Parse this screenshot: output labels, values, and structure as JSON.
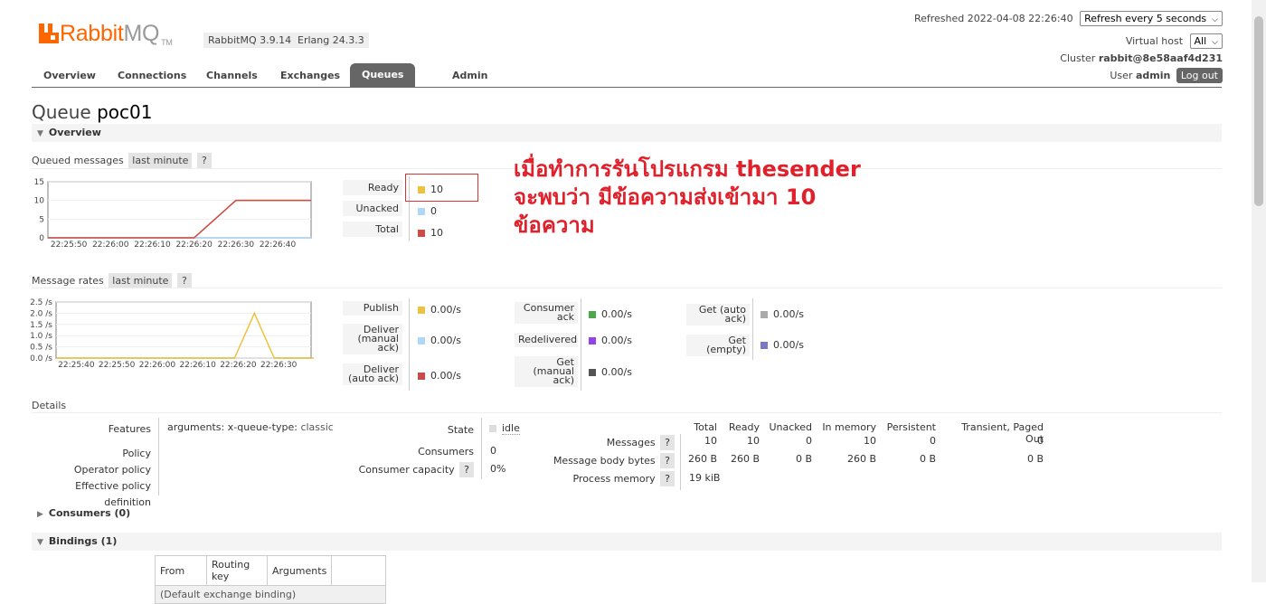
{
  "header": {
    "logo_main": "Rabbit",
    "logo_mq": "MQ",
    "logo_tm": "TM",
    "rabbitmq_version": "RabbitMQ 3.9.14",
    "erlang_version": "Erlang 24.3.3",
    "refreshed_label": "Refreshed 2022-04-08 22:26:40",
    "refresh_select": "Refresh every 5 seconds",
    "vhost_label": "Virtual host",
    "vhost_select": "All",
    "cluster_label": "Cluster",
    "cluster_name": "rabbit@8e58aaf4d231",
    "user_label": "User",
    "user_name": "admin",
    "logout_label": "Log out"
  },
  "nav": [
    "Overview",
    "Connections",
    "Channels",
    "Exchanges",
    "Queues",
    "Admin"
  ],
  "nav_active": "Queues",
  "page": {
    "title_prefix": "Queue",
    "queue_name": "poc01"
  },
  "overview_section": "Overview",
  "queued": {
    "title": "Queued messages",
    "range": "last minute",
    "help": "?",
    "rows": [
      {
        "label": "Ready",
        "value": "10",
        "color": "#edc240"
      },
      {
        "label": "Unacked",
        "value": "0",
        "color": "#afd8f8"
      },
      {
        "label": "Total",
        "value": "10",
        "color": "#cb4b4b"
      }
    ]
  },
  "rates": {
    "title": "Message rates",
    "range": "last minute",
    "help": "?",
    "col1": [
      {
        "label": "Publish",
        "value": "0.00/s",
        "color": "#edc240"
      },
      {
        "label": "Deliver (manual ack)",
        "value": "0.00/s",
        "color": "#afd8f8"
      },
      {
        "label": "Deliver (auto ack)",
        "value": "0.00/s",
        "color": "#cb4b4b"
      }
    ],
    "col2": [
      {
        "label": "Consumer ack",
        "value": "0.00/s",
        "color": "#4da74d"
      },
      {
        "label": "Redelivered",
        "value": "0.00/s",
        "color": "#9440ed"
      },
      {
        "label": "Get (manual ack)",
        "value": "0.00/s",
        "color": "#555555"
      }
    ],
    "col3": [
      {
        "label": "Get (auto ack)",
        "value": "0.00/s",
        "color": "#aaaaaa"
      },
      {
        "label": "Get (empty)",
        "value": "0.00/s",
        "color": "#7c79c3"
      }
    ]
  },
  "annotation": {
    "line1": "เมื่อทำการรันโปรแกรม thesender",
    "line2": "จะพบว่า มีข้อความส่งเข้ามา 10",
    "line3": "ข้อความ"
  },
  "details": {
    "title": "Details",
    "features_label": "Features",
    "arguments_label": "arguments:",
    "argument_key": "x-queue-type:",
    "argument_value": "classic",
    "policy_label": "Policy",
    "operator_policy_label": "Operator policy",
    "effective_policy_label": "Effective policy definition",
    "state_label": "State",
    "state_value": "idle",
    "consumers_label": "Consumers",
    "consumers_value": "0",
    "capacity_label": "Consumer capacity",
    "capacity_value": "0%",
    "help": "?",
    "stats_headers": [
      "Total",
      "Ready",
      "Unacked",
      "In memory",
      "Persistent",
      "Transient, Paged Out"
    ],
    "messages_label": "Messages",
    "messages_values": [
      "10",
      "10",
      "0",
      "10",
      "0",
      "0"
    ],
    "bytes_label": "Message body bytes",
    "bytes_values": [
      "260 B",
      "260 B",
      "0 B",
      "260 B",
      "0 B",
      "0 B"
    ],
    "process_memory_label": "Process memory",
    "process_memory_value": "19 kiB"
  },
  "consumers_section": "Consumers (0)",
  "bindings_section": "Bindings (1)",
  "bindings_table": {
    "headers": [
      "From",
      "Routing key",
      "Arguments"
    ],
    "row": "(Default exchange binding)"
  },
  "chart_data": [
    {
      "type": "line",
      "x": [
        "22:25:50",
        "22:26:00",
        "22:26:10",
        "22:26:20",
        "22:26:30",
        "22:26:40"
      ],
      "ylim": [
        0,
        15
      ],
      "yticks": [
        "15",
        "10",
        "5",
        "0"
      ],
      "series": [
        {
          "name": "Ready",
          "color": "#edc240",
          "values": [
            0,
            0,
            0,
            0,
            10,
            10
          ]
        },
        {
          "name": "Unacked",
          "color": "#afd8f8",
          "values": [
            0,
            0,
            0,
            0,
            0,
            0
          ]
        },
        {
          "name": "Total",
          "color": "#cb4b4b",
          "values": [
            0,
            0,
            0,
            0,
            10,
            10
          ]
        }
      ]
    },
    {
      "type": "line",
      "x": [
        "22:25:40",
        "22:25:50",
        "22:26:00",
        "22:26:10",
        "22:26:20",
        "22:26:30"
      ],
      "ylim": [
        0,
        2.5
      ],
      "yticks": [
        "2.5 /s",
        "2.0 /s",
        "1.5 /s",
        "1.0 /s",
        "0.5 /s",
        "0.0 /s"
      ],
      "series": [
        {
          "name": "Publish",
          "color": "#edc240",
          "points": [
            [
              0,
              0
            ],
            [
              4.5,
              0
            ],
            [
              5,
              2
            ],
            [
              5.5,
              0
            ],
            [
              6.5,
              0
            ]
          ]
        }
      ]
    }
  ]
}
